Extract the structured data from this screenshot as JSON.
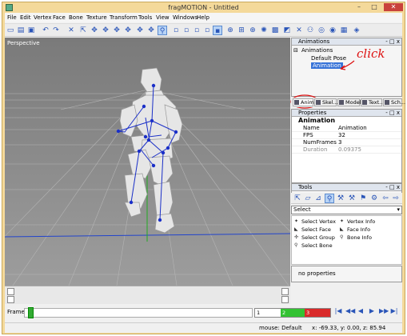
{
  "window": {
    "title": "fragMOTION - Untitled",
    "minimize": "–",
    "maximize": "□",
    "close": "✕"
  },
  "menu": [
    "File",
    "Edit",
    "Vertex",
    "Face",
    "Bone",
    "Texture",
    "Transform",
    "Tools",
    "View",
    "Windows",
    "Help"
  ],
  "viewport": {
    "label": "Perspective"
  },
  "animations_panel": {
    "title": "Animations",
    "controls": "- □ x",
    "root": "Animations",
    "items": [
      "Default Pose",
      "Animation"
    ]
  },
  "annotation": {
    "text": "click"
  },
  "tabs": [
    "Anim",
    "Skel...",
    "Model",
    "Text...",
    "Sch..."
  ],
  "properties_panel": {
    "title": "Properties",
    "section": "Animation",
    "rows": [
      {
        "key": "Name",
        "value": "Animation"
      },
      {
        "key": "FPS",
        "value": "32"
      },
      {
        "key": "NumFrames",
        "value": "3"
      },
      {
        "key": "Duration",
        "value": "0.09375"
      }
    ]
  },
  "tools_panel": {
    "title": "Tools",
    "select_value": "Select",
    "items": [
      {
        "label": "Select Vertex",
        "icon": "vertex-icon"
      },
      {
        "label": "Vertex Info",
        "icon": "vertex-info-icon"
      },
      {
        "label": "Select Face",
        "icon": "face-icon"
      },
      {
        "label": "Face Info",
        "icon": "face-info-icon"
      },
      {
        "label": "Select Group",
        "icon": "group-icon"
      },
      {
        "label": "Bone Info",
        "icon": "bone-info-icon"
      },
      {
        "label": "Select Bone",
        "icon": "bone-icon"
      }
    ],
    "no_properties": "no properties"
  },
  "timeline": {
    "label": "Frame",
    "frames": [
      "1",
      "2",
      "3"
    ],
    "playback": [
      "|◀",
      "◀◀",
      "◀",
      "▶",
      "▶▶",
      "▶|"
    ]
  },
  "status": {
    "mode": "mouse: Default",
    "coords": "x: -69.33, y: 0.00, z: 85.94"
  },
  "colors": {
    "title_bg": "#f4d99a",
    "selection": "#3874d8",
    "viewport_bg": "#8f8f8f",
    "annotation": "#dd1111"
  }
}
